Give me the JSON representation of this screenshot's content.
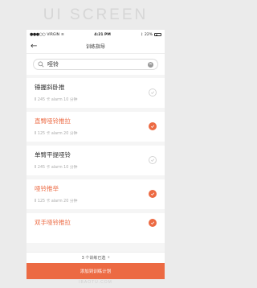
{
  "brand": "UI SCREEN",
  "status": {
    "carrier": "VIRGIN",
    "time": "4:21 PM",
    "battery": "22%"
  },
  "nav": {
    "title": "训练指导"
  },
  "search": {
    "value": "哑铃",
    "placeholder": ""
  },
  "items": [
    {
      "name": "锤握斜卧推",
      "meta": "Ⅱ 245 卡 alarm 10 分钟",
      "selected": false
    },
    {
      "name": "直臂哑铃推拉",
      "meta": "Ⅱ 125 卡 alarm 20 分钟",
      "selected": true
    },
    {
      "name": "单臂平提哑铃",
      "meta": "Ⅱ 245 卡 alarm 10 分钟",
      "selected": false
    },
    {
      "name": "哑铃推举",
      "meta": "Ⅱ 125 卡 alarm 20 分钟",
      "selected": true
    },
    {
      "name": "双手哑铃推拉",
      "meta": "",
      "selected": true
    }
  ],
  "footer": {
    "count_text": "3 个训练已选",
    "add_label": "添加到训练计划"
  },
  "watermark": "IBAOTU.COM",
  "colors": {
    "accent": "#ec6a43"
  }
}
